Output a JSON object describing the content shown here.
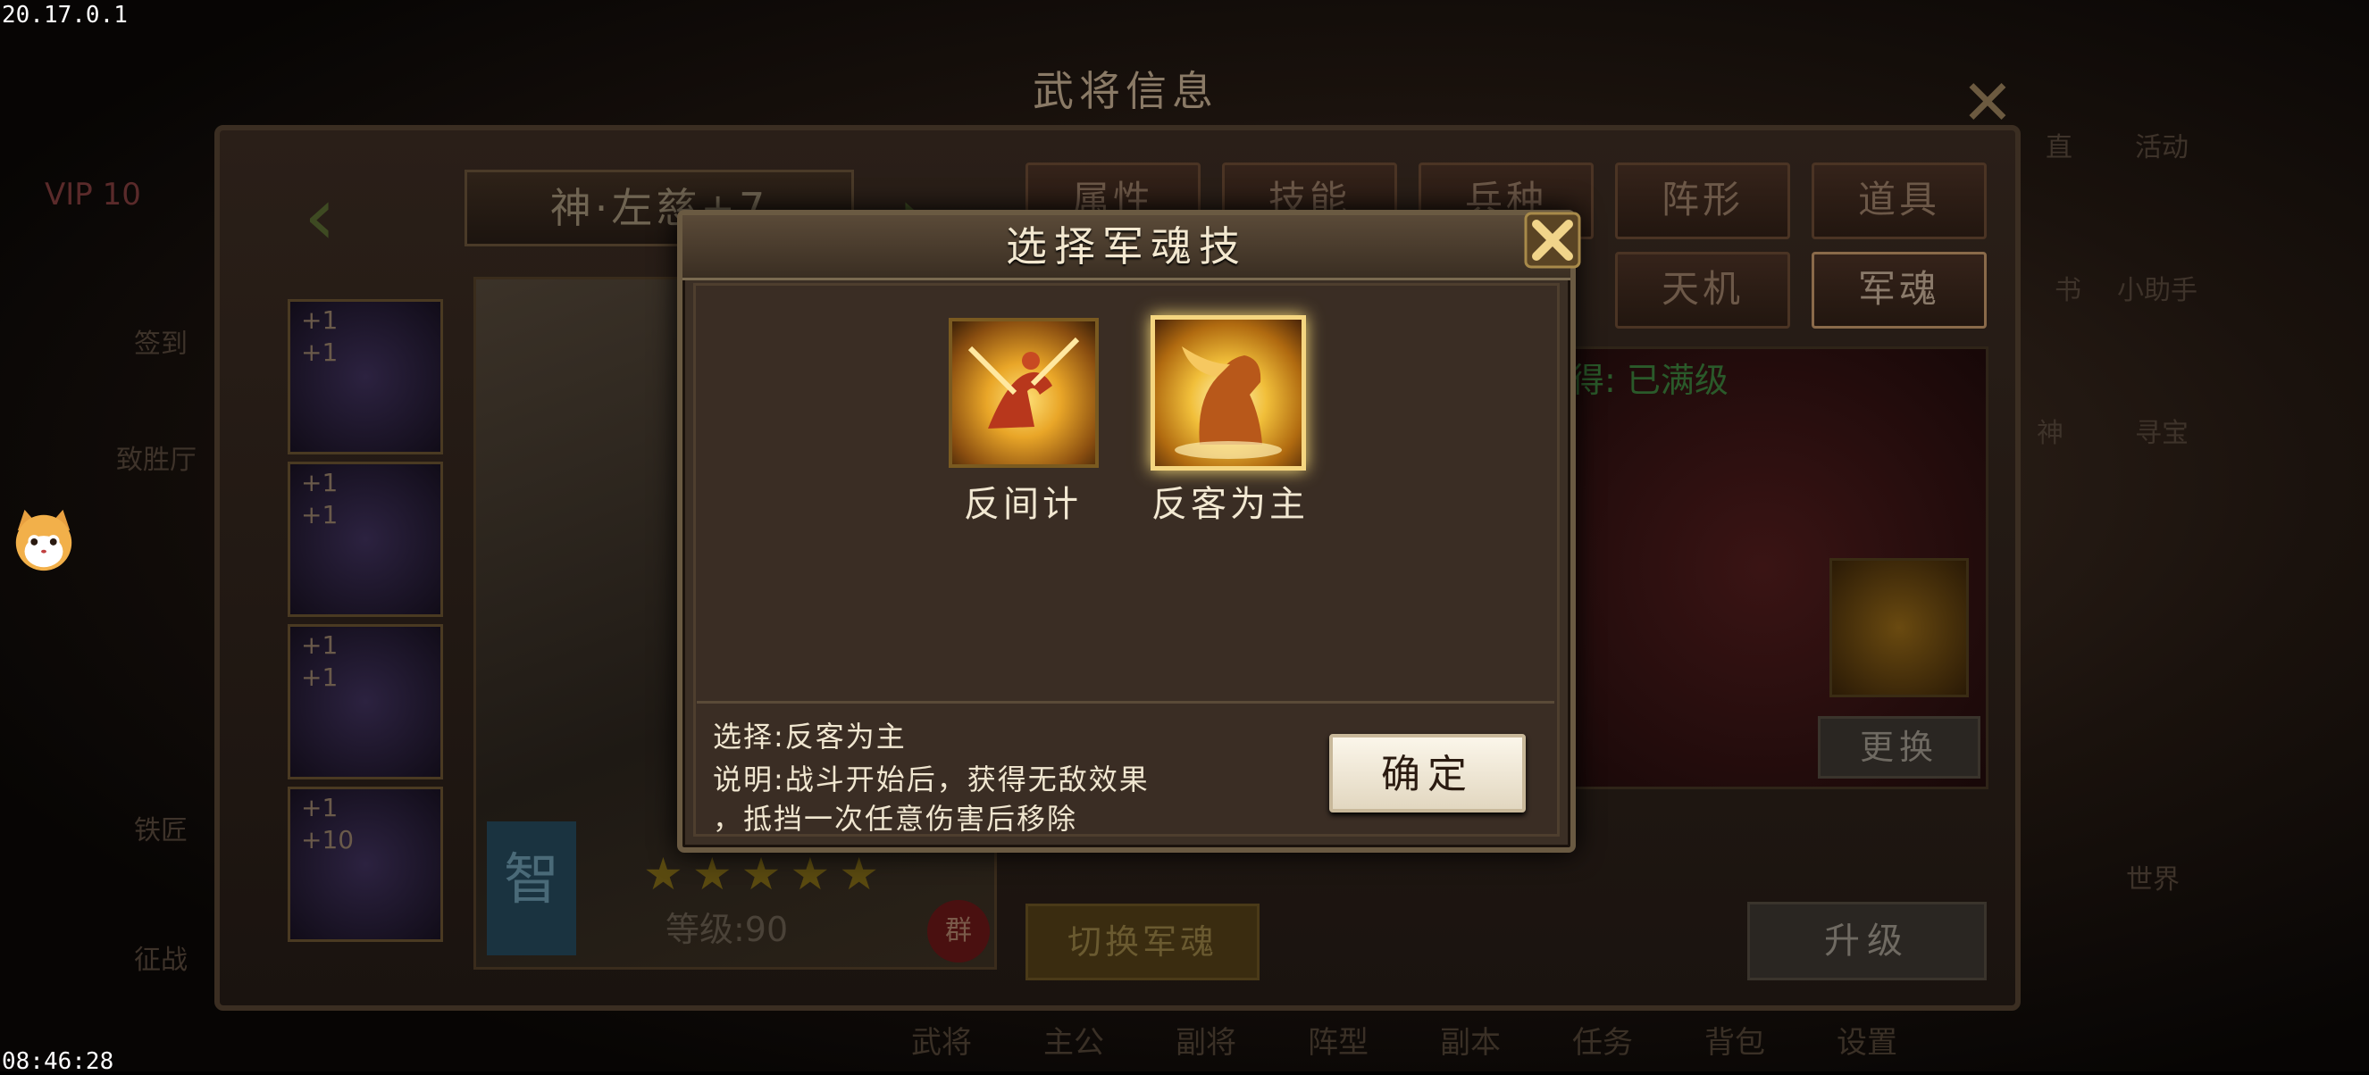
{
  "overlay": {
    "version": "20.17.0.1",
    "time": "08:46:28"
  },
  "background": {
    "page_title": "武将信息",
    "tabs_row1": [
      "属性",
      "技能",
      "兵种",
      "阵形",
      "道具"
    ],
    "tabs_row2": [
      "天机",
      "军魂"
    ],
    "hero_name": "神·左慈+7",
    "class_badge": "智",
    "level_text": "等级:90",
    "faction": "群",
    "stars": "★★★★★",
    "equip_plus": [
      "+1",
      "+1",
      "+1",
      "+1",
      "+1",
      "+1",
      "+1",
      "+10"
    ],
    "obtained_text": "获得: 已满级",
    "replace_button": "更换",
    "upgrade_button": "升级",
    "switch_button": "切换军魂",
    "vip": "VIP 10",
    "bottom_nav": [
      "武将",
      "主公",
      "副将",
      "阵型",
      "副本",
      "任务",
      "背包",
      "设置"
    ],
    "left_side_labels": [
      "签到",
      "致胜厅",
      "铁匠",
      "征战"
    ],
    "right_side_labels": [
      "直",
      "活动",
      "书",
      "小助手",
      "神",
      "寻宝",
      "世界"
    ]
  },
  "dialog": {
    "title": "选择军魂技",
    "skills": [
      {
        "name": "反间计",
        "selected": false
      },
      {
        "name": "反客为主",
        "selected": true
      }
    ],
    "selection_line": "选择:反客为主",
    "description_line1": "说明:战斗开始后，获得无敌效果",
    "description_line2": "，抵挡一次任意伤害后移除",
    "confirm_button": "确定"
  },
  "colors": {
    "dialog_bg": "#3b2f25",
    "gold": "#f5d680",
    "confirm_bg": "#f3ecdc"
  }
}
